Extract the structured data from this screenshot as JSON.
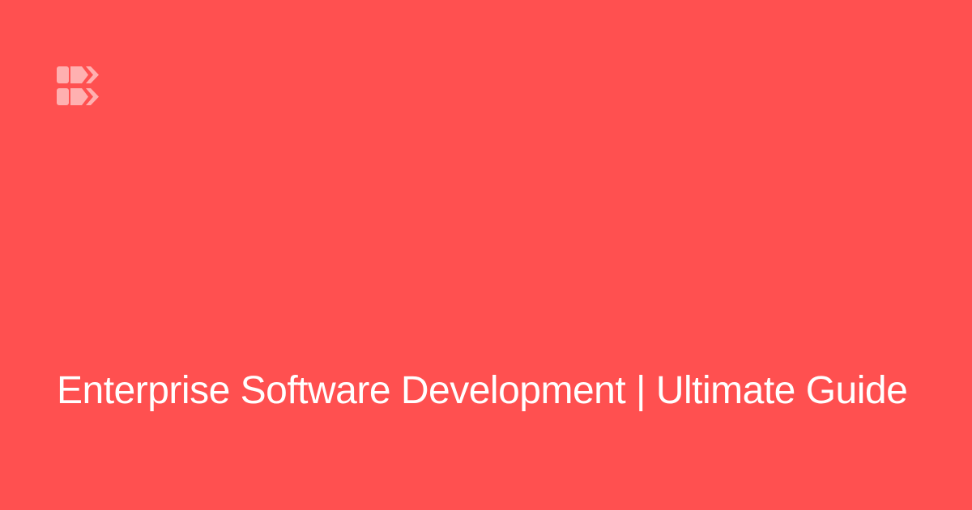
{
  "colors": {
    "background": "#FF5050",
    "text": "#FFFFFF",
    "logo": "#FFB0B0"
  },
  "logo": {
    "icon": "brand-logo-icon"
  },
  "title": "Enterprise Software Development | Ultimate Guide"
}
